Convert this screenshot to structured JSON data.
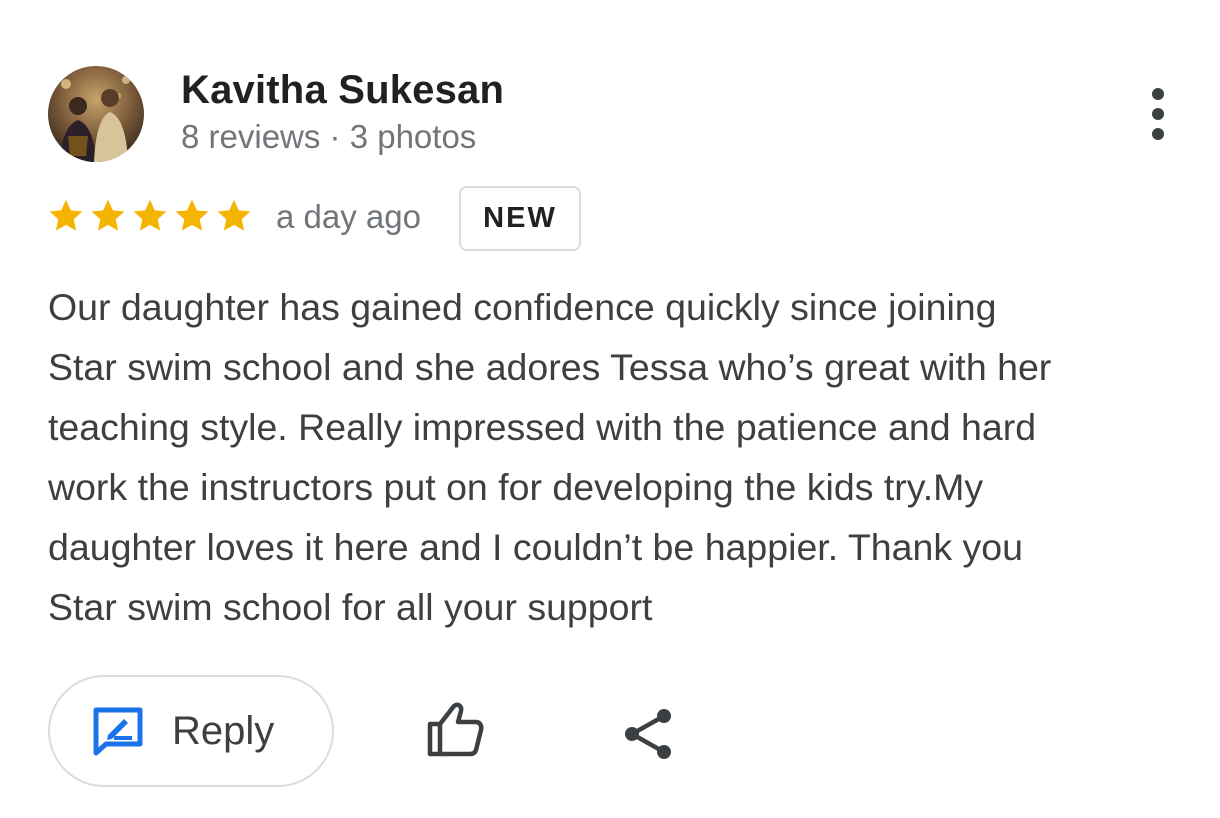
{
  "review": {
    "author_name": "Kavitha Sukesan",
    "author_meta": "8 reviews · 3 photos",
    "rating": 5,
    "rating_max": 5,
    "time_ago": "a day ago",
    "badge": "NEW",
    "text_lines": [
      "Our daughter has gained confidence quickly since joining",
      "Star swim school and she adores Tessa who’s great with her",
      "teaching style. Really impressed with the patience and hard",
      "work the instructors put on for developing the kids try.My",
      "daughter loves it here and I couldn’t be happier. Thank you",
      "Star swim school for all your support"
    ]
  },
  "actions": {
    "reply_label": "Reply",
    "reply_icon": "reply-icon",
    "like_icon": "thumbs-up-icon",
    "share_icon": "share-icon",
    "more_icon": "more-vertical-icon"
  },
  "colors": {
    "star": "#f4b400",
    "reply_icon": "#1a73e8",
    "text_primary": "#202124",
    "text_secondary": "#70757a",
    "border": "#dadce0"
  }
}
